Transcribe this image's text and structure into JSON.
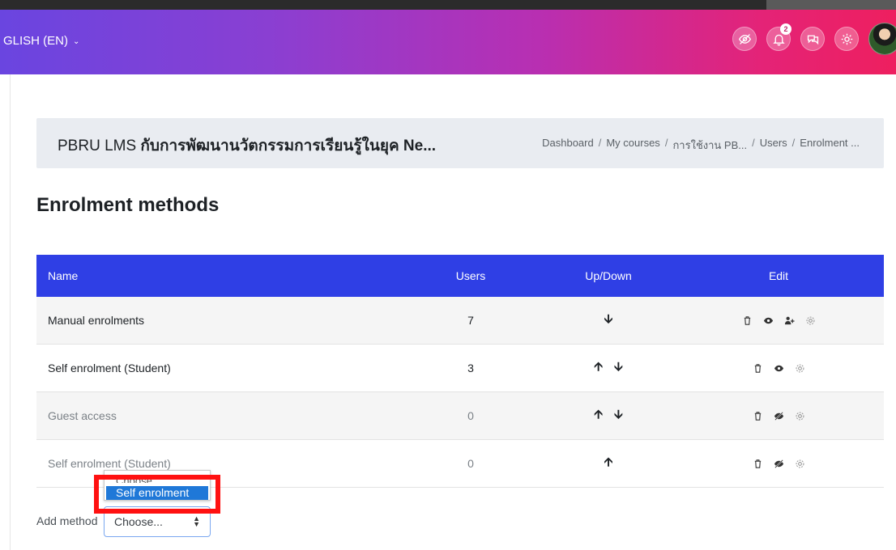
{
  "navbar": {
    "language": "GLISH (EN)",
    "notification_count": "2",
    "icons": [
      "eye-slash-icon",
      "bell-icon",
      "chat-icon",
      "gear-icon"
    ]
  },
  "header": {
    "course_prefix": "PBRU LMS ",
    "course_title": "กับการพัฒนานวัตกรรมการเรียนรู้ในยุค Ne...",
    "breadcrumb": [
      "Dashboard",
      "My courses",
      "การใช้งาน PB...",
      "Users",
      "Enrolment ..."
    ]
  },
  "page": {
    "title": "Enrolment methods"
  },
  "table": {
    "headers": {
      "name": "Name",
      "users": "Users",
      "updown": "Up/Down",
      "edit": "Edit"
    },
    "rows": [
      {
        "name": "Manual enrolments",
        "users": "7"
      },
      {
        "name": "Self enrolment (Student)",
        "users": "3"
      },
      {
        "name": "Guest access",
        "users": "0"
      },
      {
        "name": "Self enrolment (Student)",
        "users": "0"
      }
    ]
  },
  "add_method": {
    "label": "Add method",
    "selected": "Choose...",
    "options": [
      "Choose...",
      "Self enrolment"
    ]
  },
  "colors": {
    "table_header": "#2f3fe5",
    "highlight_box": "#ff1111",
    "dropdown_selected": "#1f78d8"
  }
}
